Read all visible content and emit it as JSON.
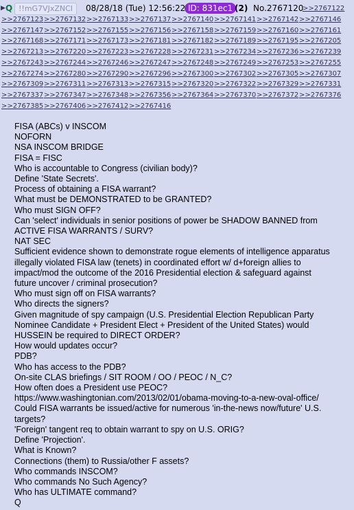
{
  "post": {
    "arrow": "▶",
    "name": "Q",
    "tripcode": "!!mG7VJxZNCI",
    "datetime": "08/28/18 (Tue) 12:56:22",
    "id_badge": "ID: 831ec1",
    "count": "(2)",
    "number": "No.2767120",
    "first_reply": ">>2767122"
  },
  "reply_rows": [
    [
      ">>2767123",
      ">>2767132",
      ">>2767133",
      ">>2767137",
      ">>2767140",
      ">>2767141",
      ">>2767142",
      ">>2767146"
    ],
    [
      ">>2767147",
      ">>2767152",
      ">>2767155",
      ">>2767156",
      ">>2767158",
      ">>2767159",
      ">>2767160",
      ">>2767161"
    ],
    [
      ">>2767168",
      ">>2767171",
      ">>2767173",
      ">>2767181",
      ">>2767182",
      ">>2767189",
      ">>2767195",
      ">>2767205"
    ],
    [
      ">>2767213",
      ">>2767220",
      ">>2767223",
      ">>2767228",
      ">>2767231",
      ">>2767234",
      ">>2767236",
      ">>2767239"
    ],
    [
      ">>2767243",
      ">>2767244",
      ">>2767246",
      ">>2767247",
      ">>2767248",
      ">>2767249",
      ">>2767253",
      ">>2767255"
    ],
    [
      ">>2767274",
      ">>2767280",
      ">>2767290",
      ">>2767296",
      ">>2767300",
      ">>2767302",
      ">>2767305",
      ">>2767307"
    ],
    [
      ">>2767309",
      ">>2767311",
      ">>2767313",
      ">>2767315",
      ">>2767320",
      ">>2767322",
      ">>2767329",
      ">>2767331"
    ],
    [
      ">>2767337",
      ">>2767347",
      ">>2767348",
      ">>2767356",
      ">>2767364",
      ">>2767370",
      ">>2767372",
      ">>2767376"
    ],
    [
      ">>2767385",
      ">>2767406",
      ">>2767412",
      ">>2767416"
    ]
  ],
  "body_lines": [
    "FISA (ABCs) v INSCOM",
    "NOFORN",
    "NSA INSCOM BRIDGE",
    "FISA = FISC",
    "Who is accountable to Congress (civilian body)?",
    "Define 'State Secrets'.",
    "Process of obtaining a FISA warrant?",
    "What must be DEMONSTRATED to be GRANTED?",
    "Who must SIGN OFF?",
    "Can 'select' individuals in senior positions of power be SHADOW BANNED from",
    "ACTIVE FISA WARRANTS / SURV?",
    "NAT SEC",
    "Sufficient evidence shown to demonstrate rogue elements of intelligence apparatus",
    "illegally violated FISA law (tenets) in coordinated effort w/ d+foreign allies to",
    "impact/mod the outcome of the 2016 Presidential election & safeguard against",
    "future uncover / criminal prosecution?",
    "Who must sign off on FISA warrants?",
    "Who directs the signers?",
    "Given magnitude of spy campaign (U.S. Presidential Election Republican Party",
    "Nominee Candidate + President Elect + President of the United States) would",
    "HUSSEIN be required to DIRECT ORDER?",
    "How would updates occur?",
    "PDB?",
    "Who has access to the PDB?",
    "On-site CLAS briefings / SIT ROOM / OO / PEOC / N_C?",
    "How often does a President use PEOC?",
    "https://www.washingtonian.com/2013/02/01/obama-moving-to-a-new-oval-office/",
    "Could FISA warrants be issued/active for numerous 'in-the-news now/future' U.S.",
    "targets?",
    "'Foreign' tangent req to obtain warrant to spy on U.S. ORIG?",
    "Define 'Projection'.",
    "What is Known?",
    "Connections (them) to Russia/other F assets?",
    "Who commands INSCOM?",
    "Who commands No Such Agency?",
    "Who has ULTIMATE command?",
    "Q"
  ]
}
